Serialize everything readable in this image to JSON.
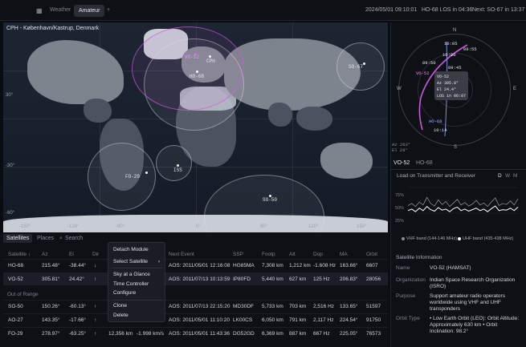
{
  "topbar": {
    "tabs": [
      "Weather",
      "Amateur"
    ],
    "add": "+",
    "datetime": "2024/05/01 09:10:01",
    "los": "HO-68 LOS in 04:36",
    "next": "Next: SO-67 in 13:37"
  },
  "map": {
    "title": "CPH - København/Kastrup, Denmark",
    "coords": [
      "30°",
      "0°",
      "-30°",
      "-60°",
      "-90°",
      "-120°",
      "-150°",
      "60°",
      "90°",
      "120°",
      "150°"
    ],
    "sats": {
      "vo52": "VO-52",
      "cph": "CPH",
      "ho68": "HO-68",
      "so67": "SO-67",
      "fo29": "FO-29",
      "iss": "ISS",
      "so50": "SO-50"
    }
  },
  "polar": {
    "compass": {
      "n": "N",
      "e": "E",
      "s": "S",
      "w": "W"
    },
    "times": [
      "10:05",
      "09:55",
      "09:45",
      "10:00",
      "09:50",
      "10:14",
      "HO-68",
      "VO-52"
    ],
    "tooltip": {
      "name": "VO-52",
      "az": "Az  305.8°",
      "el": "El  24.4°",
      "los": "LOS in 06:07"
    },
    "readout_az": "Az 263°",
    "readout_el": "El 29°"
  },
  "right_tabs": [
    "VO-52",
    "HO-68"
  ],
  "chart_title": "Load on Transmitter and Receiver",
  "chart_periods": [
    "D",
    "W",
    "M"
  ],
  "chart_yticks": [
    "75%",
    "50%",
    "25%"
  ],
  "chart_legend": [
    "VHF band (144-146 MHz)",
    "UHF band (435-438 MHz)"
  ],
  "chart_data": {
    "type": "line",
    "yticks": [
      "75%",
      "50%",
      "25%"
    ],
    "legend_position": "bottom",
    "series": [
      {
        "name": "VHF band (144-146 MHz)",
        "values": [
          40,
          44,
          38,
          47,
          41,
          56,
          44,
          39,
          51,
          42,
          48,
          38,
          45,
          52,
          41,
          46,
          39,
          43,
          50,
          41,
          45,
          38,
          47,
          55,
          40,
          44,
          42,
          49,
          41,
          53
        ]
      },
      {
        "name": "UHF band (435-438 MHz)",
        "values": [
          30,
          33,
          28,
          35,
          30,
          38,
          32,
          29,
          36,
          31,
          33,
          28,
          34,
          37,
          30,
          33,
          29,
          32,
          35,
          30,
          33,
          28,
          34,
          39,
          30,
          32,
          31,
          35,
          30,
          37
        ]
      }
    ]
  },
  "sat_info": {
    "header": "Satellite Information",
    "rows": [
      {
        "k": "Name",
        "v": "VO-52 (HAMSAT)"
      },
      {
        "k": "Organization",
        "v": "Indian Space Research Organization (ISRO)"
      },
      {
        "k": "Purpose",
        "v": "Support amateur radio operators worldwide using VHF and UHF transponders"
      },
      {
        "k": "Orbit Type",
        "v": "• Low Earth Orbit (LEO): Orbit Altitude: Approximately 630 km • Orbit Inclination: 98.2°"
      }
    ]
  },
  "bottom": {
    "tabs": [
      "Satellites",
      "Places"
    ],
    "search_placeholder": "Search",
    "columns": [
      "Satellite ↓",
      "Az",
      "El",
      "Dir",
      "Next Event",
      "SSP",
      "Footp",
      "Alt",
      "Dop",
      "MA",
      "Orbit"
    ],
    "in_range": [
      {
        "name": "HO-68",
        "az": "215.48°",
        "el": "-38.44°",
        "dir": "↓",
        "speed": "",
        "rate": "",
        "event": "AOS: 2011/05/01 12:16:08",
        "ssp": "HG65MA",
        "footp": "7,308 km",
        "alt": "1,212 km",
        "dop": "-1.608 Hz",
        "ma": "163.66°",
        "orbit": "6607"
      },
      {
        "name": "VO-52",
        "az": "305.81°",
        "el": "24.42°",
        "dir": "↑",
        "speed": "",
        "rate": "",
        "event": "AOS: 2011/07/13 10:13:59",
        "ssp": "IP80FD",
        "footp": "5,440 km",
        "alt": "627 km",
        "dop": "125 Hz",
        "ma": "206.83°",
        "orbit": "28056"
      }
    ],
    "out_label": "Out of Range",
    "out_range": [
      {
        "name": "SO-50",
        "az": "150.26°",
        "el": "-60.13°",
        "dir": "↑",
        "speed": "",
        "rate": "",
        "event": "AOS: 2011/07/13 22:15:20",
        "ssp": "MD30DF",
        "footp": "5,733 km",
        "alt": "703 km",
        "dop": "2,516 Hz",
        "ma": "133.65°",
        "orbit": "51597"
      },
      {
        "name": "AO-27",
        "az": "143.35°",
        "el": "-17.66°",
        "dir": "↑",
        "speed": "",
        "rate": "",
        "event": "AOS: 2011/05/01 11:10:20",
        "ssp": "LK00CS",
        "footp": "6,050 km",
        "alt": "791 km",
        "dop": "2,117 Hz",
        "ma": "224.54°",
        "orbit": "91750"
      },
      {
        "name": "FO-29",
        "az": "278.97°",
        "el": "-63.25°",
        "dir": "↑",
        "speed": "12,356 km",
        "rate": "-1.998 km/s",
        "event": "AOS: 2011/05/01 11:43:36",
        "ssp": "DG52GD",
        "footp": "6,369 km",
        "alt": "887 km",
        "dop": "667 Hz",
        "ma": "225.05°",
        "orbit": "76573"
      }
    ]
  },
  "context_menu": [
    "Detach Module",
    "Select Satellite",
    "Sky at a Glance",
    "Time Controller",
    "Configure",
    "Clone",
    "Delete"
  ],
  "colors": {
    "accent": "#c85ad8",
    "bg": "#0b0c12",
    "panel": "#0f1016"
  }
}
